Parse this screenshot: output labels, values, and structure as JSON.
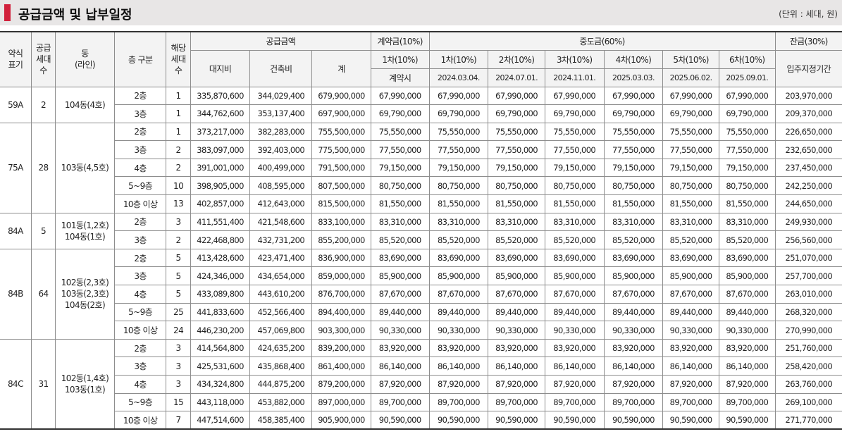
{
  "title": "공급금액 및 납부일정",
  "unit_note": "(단위 : 세대, 원)",
  "header": {
    "type": "약식\n표기",
    "supply_units": "공급\n세대\n수",
    "dong": "동\n(라인)",
    "floor": "층 구분",
    "units": "해당\n세대\n수",
    "supply_price": "공급금액",
    "land": "대지비",
    "building": "건축비",
    "total": "계",
    "deposit": "계약금(10%)",
    "deposit_1": "1차(10%)",
    "deposit_1_date": "계약시",
    "middle": "중도금(60%)",
    "middle_installments": [
      {
        "label": "1차(10%)",
        "date": "2024.03.04."
      },
      {
        "label": "2차(10%)",
        "date": "2024.07.01."
      },
      {
        "label": "3차(10%)",
        "date": "2024.11.01."
      },
      {
        "label": "4차(10%)",
        "date": "2025.03.03."
      },
      {
        "label": "5차(10%)",
        "date": "2025.06.02."
      },
      {
        "label": "6차(10%)",
        "date": "2025.09.01."
      }
    ],
    "balance": "잔금(30%)",
    "balance_date": "입주지정기간"
  },
  "groups": [
    {
      "type": "59A",
      "supply": "2",
      "dong": "104동(4호)",
      "rows": [
        {
          "floor": "2층",
          "units": "1",
          "land": "335,870,600",
          "building": "344,029,400",
          "total": "679,900,000",
          "deposit": "67,990,000",
          "mid": "67,990,000",
          "balance": "203,970,000"
        },
        {
          "floor": "3층",
          "units": "1",
          "land": "344,762,600",
          "building": "353,137,400",
          "total": "697,900,000",
          "deposit": "69,790,000",
          "mid": "69,790,000",
          "balance": "209,370,000"
        }
      ]
    },
    {
      "type": "75A",
      "supply": "28",
      "dong": "103동(4,5호)",
      "rows": [
        {
          "floor": "2층",
          "units": "1",
          "land": "373,217,000",
          "building": "382,283,000",
          "total": "755,500,000",
          "deposit": "75,550,000",
          "mid": "75,550,000",
          "balance": "226,650,000"
        },
        {
          "floor": "3층",
          "units": "2",
          "land": "383,097,000",
          "building": "392,403,000",
          "total": "775,500,000",
          "deposit": "77,550,000",
          "mid": "77,550,000",
          "balance": "232,650,000"
        },
        {
          "floor": "4층",
          "units": "2",
          "land": "391,001,000",
          "building": "400,499,000",
          "total": "791,500,000",
          "deposit": "79,150,000",
          "mid": "79,150,000",
          "balance": "237,450,000"
        },
        {
          "floor": "5~9층",
          "units": "10",
          "land": "398,905,000",
          "building": "408,595,000",
          "total": "807,500,000",
          "deposit": "80,750,000",
          "mid": "80,750,000",
          "balance": "242,250,000"
        },
        {
          "floor": "10층 이상",
          "units": "13",
          "land": "402,857,000",
          "building": "412,643,000",
          "total": "815,500,000",
          "deposit": "81,550,000",
          "mid": "81,550,000",
          "balance": "244,650,000"
        }
      ]
    },
    {
      "type": "84A",
      "supply": "5",
      "dong": "101동(1,2호)\n104동(1호)",
      "rows": [
        {
          "floor": "2층",
          "units": "3",
          "land": "411,551,400",
          "building": "421,548,600",
          "total": "833,100,000",
          "deposit": "83,310,000",
          "mid": "83,310,000",
          "balance": "249,930,000"
        },
        {
          "floor": "3층",
          "units": "2",
          "land": "422,468,800",
          "building": "432,731,200",
          "total": "855,200,000",
          "deposit": "85,520,000",
          "mid": "85,520,000",
          "balance": "256,560,000"
        }
      ]
    },
    {
      "type": "84B",
      "supply": "64",
      "dong": "102동(2,3호)\n103동(2,3호)\n104동(2호)",
      "rows": [
        {
          "floor": "2층",
          "units": "5",
          "land": "413,428,600",
          "building": "423,471,400",
          "total": "836,900,000",
          "deposit": "83,690,000",
          "mid": "83,690,000",
          "balance": "251,070,000"
        },
        {
          "floor": "3층",
          "units": "5",
          "land": "424,346,000",
          "building": "434,654,000",
          "total": "859,000,000",
          "deposit": "85,900,000",
          "mid": "85,900,000",
          "balance": "257,700,000"
        },
        {
          "floor": "4층",
          "units": "5",
          "land": "433,089,800",
          "building": "443,610,200",
          "total": "876,700,000",
          "deposit": "87,670,000",
          "mid": "87,670,000",
          "balance": "263,010,000"
        },
        {
          "floor": "5~9층",
          "units": "25",
          "land": "441,833,600",
          "building": "452,566,400",
          "total": "894,400,000",
          "deposit": "89,440,000",
          "mid": "89,440,000",
          "balance": "268,320,000"
        },
        {
          "floor": "10층 이상",
          "units": "24",
          "land": "446,230,200",
          "building": "457,069,800",
          "total": "903,300,000",
          "deposit": "90,330,000",
          "mid": "90,330,000",
          "balance": "270,990,000"
        }
      ]
    },
    {
      "type": "84C",
      "supply": "31",
      "dong": "102동(1,4호)\n103동(1호)",
      "rows": [
        {
          "floor": "2층",
          "units": "3",
          "land": "414,564,800",
          "building": "424,635,200",
          "total": "839,200,000",
          "deposit": "83,920,000",
          "mid": "83,920,000",
          "balance": "251,760,000"
        },
        {
          "floor": "3층",
          "units": "3",
          "land": "425,531,600",
          "building": "435,868,400",
          "total": "861,400,000",
          "deposit": "86,140,000",
          "mid": "86,140,000",
          "balance": "258,420,000"
        },
        {
          "floor": "4층",
          "units": "3",
          "land": "434,324,800",
          "building": "444,875,200",
          "total": "879,200,000",
          "deposit": "87,920,000",
          "mid": "87,920,000",
          "balance": "263,760,000"
        },
        {
          "floor": "5~9층",
          "units": "15",
          "land": "443,118,000",
          "building": "453,882,000",
          "total": "897,000,000",
          "deposit": "89,700,000",
          "mid": "89,700,000",
          "balance": "269,100,000"
        },
        {
          "floor": "10층 이상",
          "units": "7",
          "land": "447,514,600",
          "building": "458,385,400",
          "total": "905,900,000",
          "deposit": "90,590,000",
          "mid": "90,590,000",
          "balance": "271,770,000"
        }
      ]
    }
  ]
}
